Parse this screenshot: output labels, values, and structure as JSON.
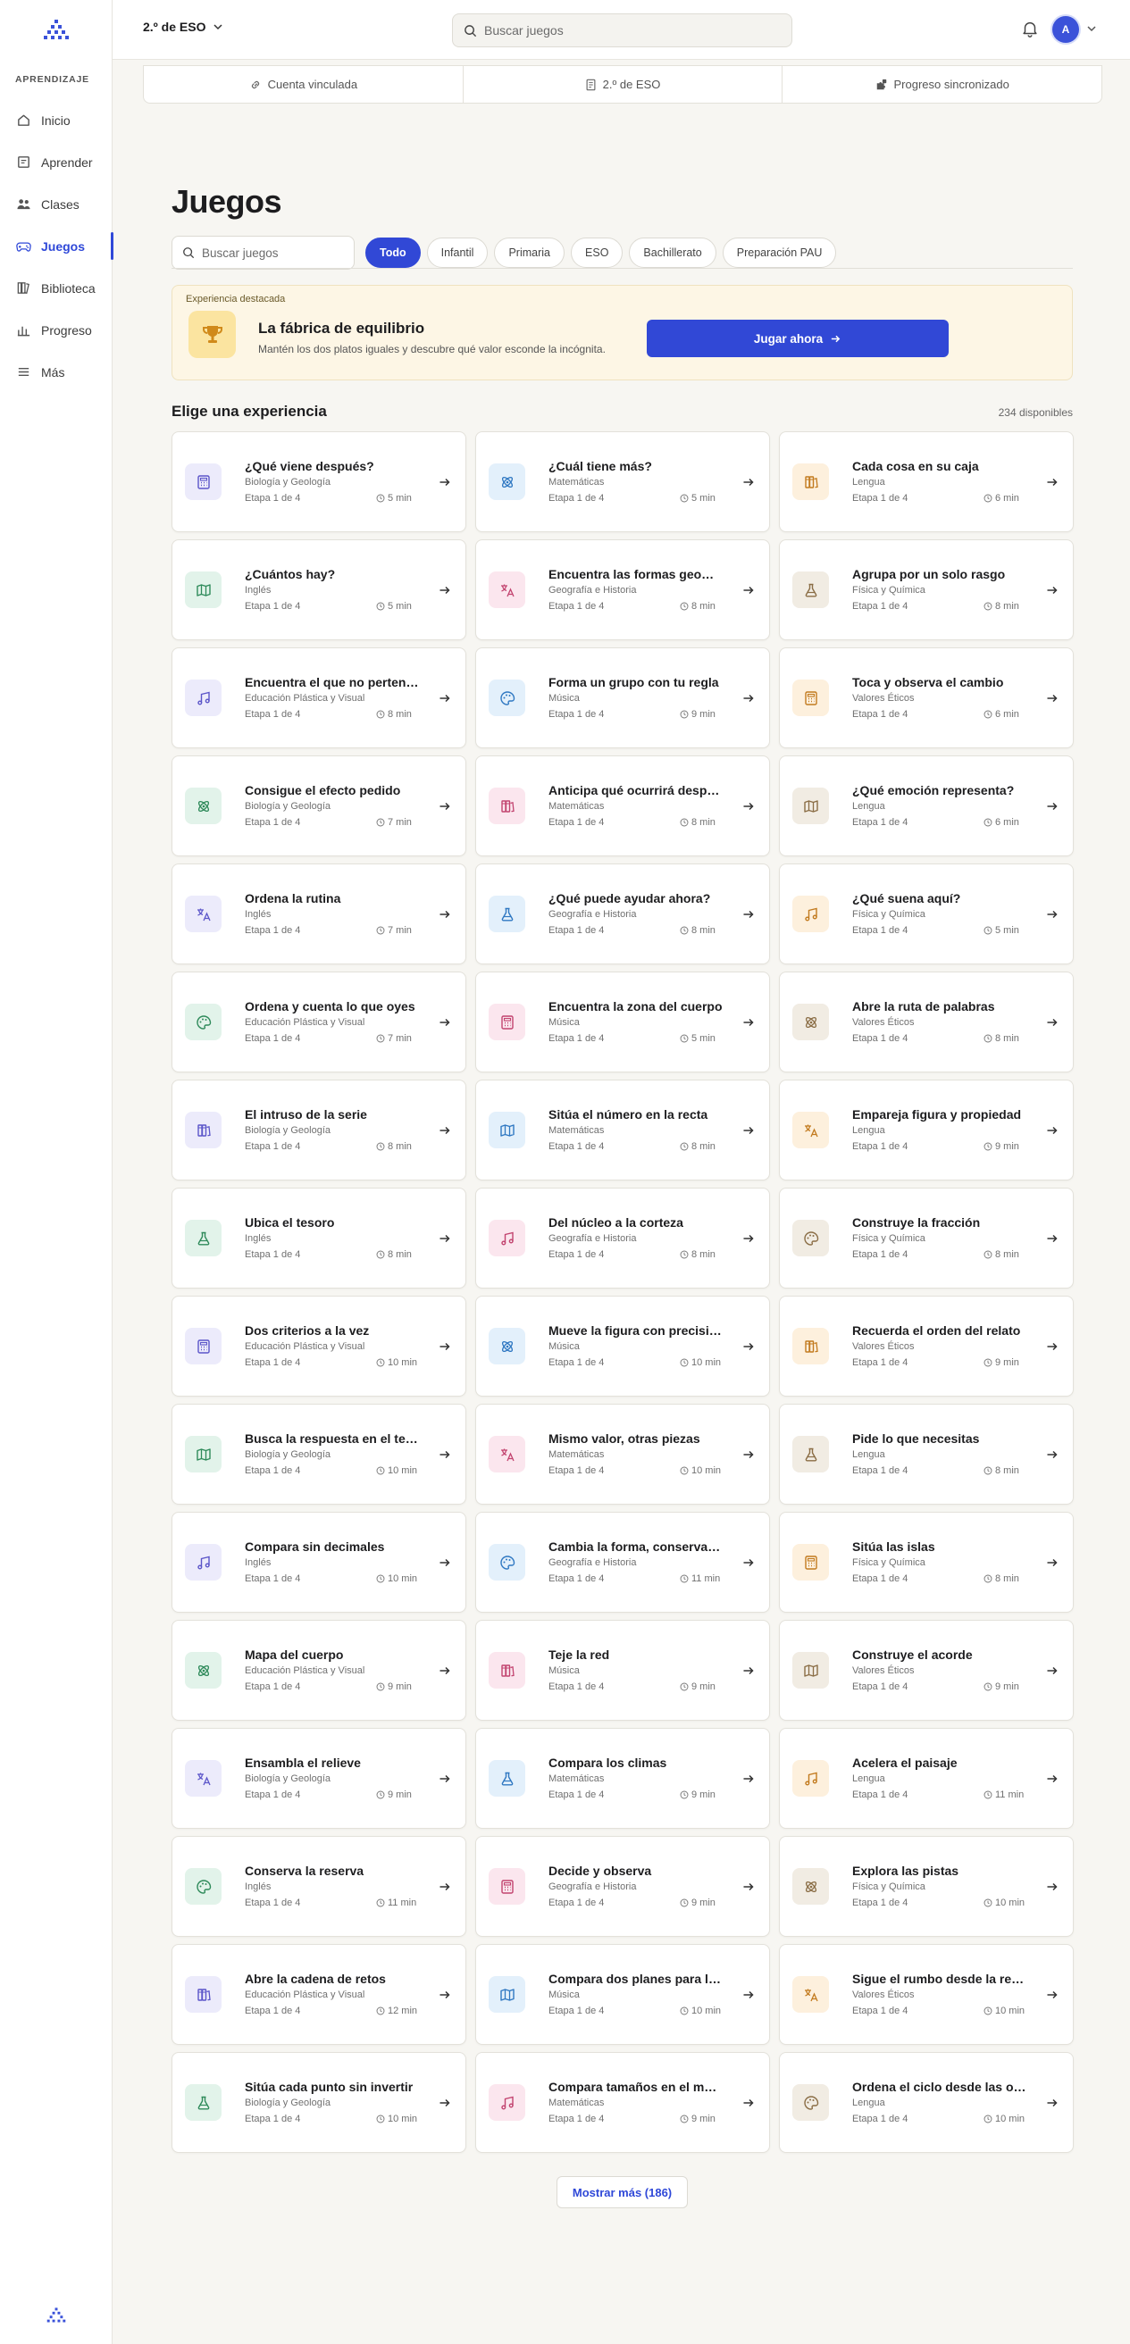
{
  "sidebar": {
    "section_label": "APRENDIZAJE",
    "items": [
      {
        "label": "Inicio",
        "icon": "home-icon",
        "active": false
      },
      {
        "label": "Aprender",
        "icon": "book-icon",
        "active": false
      },
      {
        "label": "Clases",
        "icon": "people-icon",
        "active": false
      },
      {
        "label": "Juegos",
        "icon": "gamepad-icon",
        "active": true
      },
      {
        "label": "Biblioteca",
        "icon": "library-icon",
        "active": false
      },
      {
        "label": "Progreso",
        "icon": "bar-chart-icon",
        "active": false
      },
      {
        "label": "Más",
        "icon": "menu-icon",
        "active": false
      }
    ]
  },
  "topbar": {
    "course": "2.º de ESO",
    "search_placeholder": "Buscar juegos",
    "avatar_initial": "A"
  },
  "status": {
    "linked": "Cuenta vinculada",
    "course": "2.º de ESO",
    "sync": "Progreso sincronizado"
  },
  "main": {
    "title": "Juegos",
    "search_placeholder": "Buscar juegos",
    "filters": [
      "Todo",
      "Infantil",
      "Primaria",
      "ESO",
      "Bachillerato",
      "Preparación PAU"
    ],
    "active_filter": "Todo"
  },
  "featured": {
    "label": "Experiencia destacada",
    "title": "La fábrica de equilibrio",
    "description": "Mantén los dos platos iguales y descubre qué valor esconde la incógnita.",
    "button": "Jugar ahora"
  },
  "section": {
    "title": "Elige una experiencia",
    "count": "234 disponibles"
  },
  "cards": [
    {
      "title": "¿Qué viene después?",
      "subject": "Biología y Geología",
      "stage": "Etapa 1 de 4",
      "time": "5 min",
      "icon": "calculator-icon",
      "color": "purple"
    },
    {
      "title": "¿Cuál tiene más?",
      "subject": "Matemáticas",
      "stage": "Etapa 1 de 4",
      "time": "5 min",
      "icon": "atom-icon",
      "color": "blue"
    },
    {
      "title": "Cada cosa en su caja",
      "subject": "Lengua",
      "stage": "Etapa 1 de 4",
      "time": "6 min",
      "icon": "books-icon",
      "color": "orange"
    },
    {
      "title": "¿Cuántos hay?",
      "subject": "Inglés",
      "stage": "Etapa 1 de 4",
      "time": "5 min",
      "icon": "map-icon",
      "color": "green"
    },
    {
      "title": "Encuentra las formas geométricas",
      "subject": "Geografía e Historia",
      "stage": "Etapa 1 de 4",
      "time": "8 min",
      "icon": "translate-icon",
      "color": "pink"
    },
    {
      "title": "Agrupa por un solo rasgo",
      "subject": "Física y Química",
      "stage": "Etapa 1 de 4",
      "time": "8 min",
      "icon": "flask-icon",
      "color": "beige"
    },
    {
      "title": "Encuentra el que no pertenece",
      "subject": "Educación Plástica y Visual",
      "stage": "Etapa 1 de 4",
      "time": "8 min",
      "icon": "music-icon",
      "color": "purple"
    },
    {
      "title": "Forma un grupo con tu regla",
      "subject": "Música",
      "stage": "Etapa 1 de 4",
      "time": "9 min",
      "icon": "palette-icon",
      "color": "blue"
    },
    {
      "title": "Toca y observa el cambio",
      "subject": "Valores Éticos",
      "stage": "Etapa 1 de 4",
      "time": "6 min",
      "icon": "calculator-icon",
      "color": "orange"
    },
    {
      "title": "Consigue el efecto pedido",
      "subject": "Biología y Geología",
      "stage": "Etapa 1 de 4",
      "time": "7 min",
      "icon": "atom-icon",
      "color": "green"
    },
    {
      "title": "Anticipa qué ocurrirá después",
      "subject": "Matemáticas",
      "stage": "Etapa 1 de 4",
      "time": "8 min",
      "icon": "books-icon",
      "color": "pink"
    },
    {
      "title": "¿Qué emoción representa?",
      "subject": "Lengua",
      "stage": "Etapa 1 de 4",
      "time": "6 min",
      "icon": "map-icon",
      "color": "beige"
    },
    {
      "title": "Ordena la rutina",
      "subject": "Inglés",
      "stage": "Etapa 1 de 4",
      "time": "7 min",
      "icon": "translate-icon",
      "color": "purple"
    },
    {
      "title": "¿Qué puede ayudar ahora?",
      "subject": "Geografía e Historia",
      "stage": "Etapa 1 de 4",
      "time": "8 min",
      "icon": "flask-icon",
      "color": "blue"
    },
    {
      "title": "¿Qué suena aquí?",
      "subject": "Física y Química",
      "stage": "Etapa 1 de 4",
      "time": "5 min",
      "icon": "music-icon",
      "color": "orange"
    },
    {
      "title": "Ordena y cuenta lo que oyes",
      "subject": "Educación Plástica y Visual",
      "stage": "Etapa 1 de 4",
      "time": "7 min",
      "icon": "palette-icon",
      "color": "green"
    },
    {
      "title": "Encuentra la zona del cuerpo",
      "subject": "Música",
      "stage": "Etapa 1 de 4",
      "time": "5 min",
      "icon": "calculator-icon",
      "color": "pink"
    },
    {
      "title": "Abre la ruta de palabras",
      "subject": "Valores Éticos",
      "stage": "Etapa 1 de 4",
      "time": "8 min",
      "icon": "atom-icon",
      "color": "beige"
    },
    {
      "title": "El intruso de la serie",
      "subject": "Biología y Geología",
      "stage": "Etapa 1 de 4",
      "time": "8 min",
      "icon": "books-icon",
      "color": "purple"
    },
    {
      "title": "Sitúa el número en la recta",
      "subject": "Matemáticas",
      "stage": "Etapa 1 de 4",
      "time": "8 min",
      "icon": "map-icon",
      "color": "blue"
    },
    {
      "title": "Empareja figura y propiedad",
      "subject": "Lengua",
      "stage": "Etapa 1 de 4",
      "time": "9 min",
      "icon": "translate-icon",
      "color": "orange"
    },
    {
      "title": "Ubica el tesoro",
      "subject": "Inglés",
      "stage": "Etapa 1 de 4",
      "time": "8 min",
      "icon": "flask-icon",
      "color": "green"
    },
    {
      "title": "Del núcleo a la corteza",
      "subject": "Geografía e Historia",
      "stage": "Etapa 1 de 4",
      "time": "8 min",
      "icon": "music-icon",
      "color": "pink"
    },
    {
      "title": "Construye la fracción",
      "subject": "Física y Química",
      "stage": "Etapa 1 de 4",
      "time": "8 min",
      "icon": "palette-icon",
      "color": "beige"
    },
    {
      "title": "Dos criterios a la vez",
      "subject": "Educación Plástica y Visual",
      "stage": "Etapa 1 de 4",
      "time": "10 min",
      "icon": "calculator-icon",
      "color": "purple"
    },
    {
      "title": "Mueve la figura con precisión",
      "subject": "Música",
      "stage": "Etapa 1 de 4",
      "time": "10 min",
      "icon": "atom-icon",
      "color": "blue"
    },
    {
      "title": "Recuerda el orden del relato",
      "subject": "Valores Éticos",
      "stage": "Etapa 1 de 4",
      "time": "9 min",
      "icon": "books-icon",
      "color": "orange"
    },
    {
      "title": "Busca la respuesta en el texto",
      "subject": "Biología y Geología",
      "stage": "Etapa 1 de 4",
      "time": "10 min",
      "icon": "map-icon",
      "color": "green"
    },
    {
      "title": "Mismo valor, otras piezas",
      "subject": "Matemáticas",
      "stage": "Etapa 1 de 4",
      "time": "10 min",
      "icon": "translate-icon",
      "color": "pink"
    },
    {
      "title": "Pide lo que necesitas",
      "subject": "Lengua",
      "stage": "Etapa 1 de 4",
      "time": "8 min",
      "icon": "flask-icon",
      "color": "beige"
    },
    {
      "title": "Compara sin decimales",
      "subject": "Inglés",
      "stage": "Etapa 1 de 4",
      "time": "10 min",
      "icon": "music-icon",
      "color": "purple"
    },
    {
      "title": "Cambia la forma, conserva el área",
      "subject": "Geografía e Historia",
      "stage": "Etapa 1 de 4",
      "time": "11 min",
      "icon": "palette-icon",
      "color": "blue"
    },
    {
      "title": "Sitúa las islas",
      "subject": "Física y Química",
      "stage": "Etapa 1 de 4",
      "time": "8 min",
      "icon": "calculator-icon",
      "color": "orange"
    },
    {
      "title": "Mapa del cuerpo",
      "subject": "Educación Plástica y Visual",
      "stage": "Etapa 1 de 4",
      "time": "9 min",
      "icon": "atom-icon",
      "color": "green"
    },
    {
      "title": "Teje la red",
      "subject": "Música",
      "stage": "Etapa 1 de 4",
      "time": "9 min",
      "icon": "books-icon",
      "color": "pink"
    },
    {
      "title": "Construye el acorde",
      "subject": "Valores Éticos",
      "stage": "Etapa 1 de 4",
      "time": "9 min",
      "icon": "map-icon",
      "color": "beige"
    },
    {
      "title": "Ensambla el relieve",
      "subject": "Biología y Geología",
      "stage": "Etapa 1 de 4",
      "time": "9 min",
      "icon": "translate-icon",
      "color": "purple"
    },
    {
      "title": "Compara los climas",
      "subject": "Matemáticas",
      "stage": "Etapa 1 de 4",
      "time": "9 min",
      "icon": "flask-icon",
      "color": "blue"
    },
    {
      "title": "Acelera el paisaje",
      "subject": "Lengua",
      "stage": "Etapa 1 de 4",
      "time": "11 min",
      "icon": "music-icon",
      "color": "orange"
    },
    {
      "title": "Conserva la reserva",
      "subject": "Inglés",
      "stage": "Etapa 1 de 4",
      "time": "11 min",
      "icon": "palette-icon",
      "color": "green"
    },
    {
      "title": "Decide y observa",
      "subject": "Geografía e Historia",
      "stage": "Etapa 1 de 4",
      "time": "9 min",
      "icon": "calculator-icon",
      "color": "pink"
    },
    {
      "title": "Explora las pistas",
      "subject": "Física y Química",
      "stage": "Etapa 1 de 4",
      "time": "10 min",
      "icon": "atom-icon",
      "color": "beige"
    },
    {
      "title": "Abre la cadena de retos",
      "subject": "Educación Plástica y Visual",
      "stage": "Etapa 1 de 4",
      "time": "12 min",
      "icon": "books-icon",
      "color": "purple"
    },
    {
      "title": "Compara dos planes para llegar",
      "subject": "Música",
      "stage": "Etapa 1 de 4",
      "time": "10 min",
      "icon": "map-icon",
      "color": "blue"
    },
    {
      "title": "Sigue el rumbo desde la rejilla",
      "subject": "Valores Éticos",
      "stage": "Etapa 1 de 4",
      "time": "10 min",
      "icon": "translate-icon",
      "color": "orange"
    },
    {
      "title": "Sitúa cada punto sin invertir",
      "subject": "Biología y Geología",
      "stage": "Etapa 1 de 4",
      "time": "10 min",
      "icon": "flask-icon",
      "color": "green"
    },
    {
      "title": "Compara tamaños en el mapa",
      "subject": "Matemáticas",
      "stage": "Etapa 1 de 4",
      "time": "9 min",
      "icon": "music-icon",
      "color": "pink"
    },
    {
      "title": "Ordena el ciclo desde las olas",
      "subject": "Lengua",
      "stage": "Etapa 1 de 4",
      "time": "10 min",
      "icon": "palette-icon",
      "color": "beige"
    }
  ],
  "more_button": "Mostrar más (186)",
  "colors": {
    "accent": "#3148d6",
    "purple": [
      "#ecebfb",
      "#5b55c9"
    ],
    "blue": [
      "#e3f0fb",
      "#2f78c2"
    ],
    "orange": [
      "#fdf0dd",
      "#c27a1e"
    ],
    "green": [
      "#e2f3ea",
      "#2e8a5a"
    ],
    "pink": [
      "#fbe6ee",
      "#c2436f"
    ],
    "beige": [
      "#f1ece3",
      "#8a6d45"
    ]
  }
}
